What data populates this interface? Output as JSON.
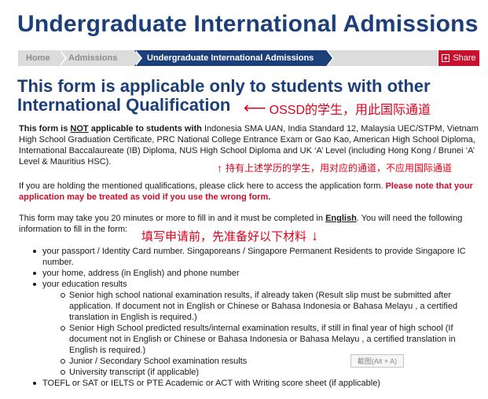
{
  "page": {
    "title": "Undergraduate International Admissions"
  },
  "breadcrumb": {
    "items": [
      {
        "label": "Home"
      },
      {
        "label": "Admissions"
      },
      {
        "label": "Undergraduate International Admissions"
      }
    ]
  },
  "share": {
    "label": "Share"
  },
  "main": {
    "heading": "This form is applicable only to students with other International Qualification",
    "annotation_1": "OSSD的学生，用此国际通道",
    "para1_prefix": "This form is ",
    "para1_not": "NOT",
    "para1_mid": " applicable to students with",
    "para1_rest": " Indonesia SMA UAN, India Standard 12, Malaysia UEC/STPM, Vietnam High School Graduation Certificate, PRC National College Entrance Exam or Gao Kao, American High School Diploma, International Baccalaureate (IB) Diploma, NUS High School Diploma and UK ‘A’ Level (including Hong Kong / Brunei ‘A’ Level & Mauritius HSC).",
    "annotation_2": "持有上述学历的学生，用对应的通道，不应用国际通道",
    "para2_prefix": "If you are holding the mentioned qualifications, please click ",
    "para2_link": "here",
    "para2_suffix": " to access the application form. ",
    "para2_warning": "Please note that your application may be treated as void if you use the wrong form.",
    "para3_prefix": "This form may take you 20 minutes or more to fill in and it must be completed in ",
    "para3_lang": "English",
    "para3_suffix": ". You will need the following information to fill in the form:",
    "annotation_3": "填写申请前，先准备好以下材料",
    "requirements": {
      "item1": "your passport / Identity Card number. Singaporeans / Singapore Permanent Residents to provide Singapore IC number.",
      "item2": "your home, address (in English) and phone number",
      "item3": "your education results",
      "sub1": "Senior high school national examination results, if already taken (Result slip must be submitted after application. If document not in English or Chinese or Bahasa Indonesia or Bahasa Melayu , a certified translation in English is required.)",
      "sub2": "Senior High School predicted results/internal examination results, if still in final year of high school (If document not in English or Chinese or Bahasa Indonesia or Bahasa Melayu , a certified translation in English is required.)",
      "sub3": "Junior / Secondary School examination results",
      "sub4": "University transcript (if applicable)",
      "item4": "TOEFL or SAT or IELTS or PTE Academic or ACT with Writing score sheet (if applicable)"
    }
  },
  "tooltip": {
    "label": "截图(Alt + A)"
  },
  "colors": {
    "brand_blue": "#1c3f79",
    "share_red": "#c8102e",
    "annotation_red": "#e0001b"
  }
}
